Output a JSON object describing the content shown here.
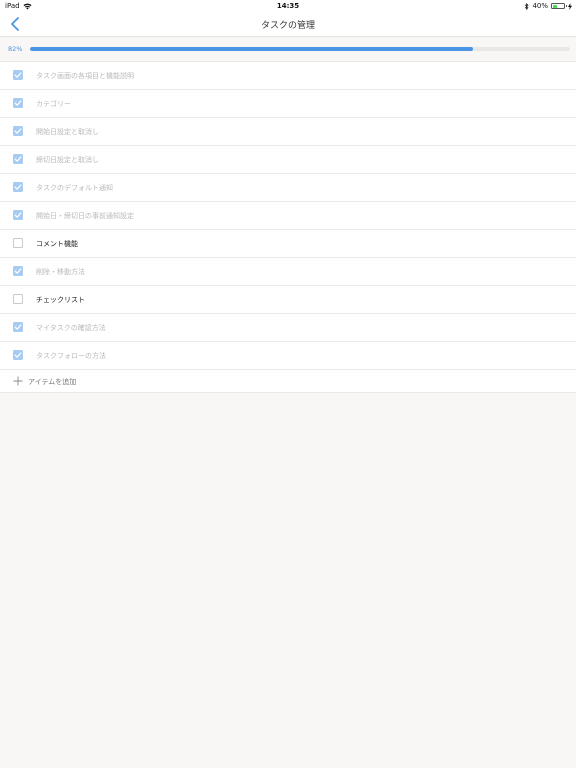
{
  "status_bar": {
    "device": "iPad",
    "time": "14:35",
    "battery": "40%",
    "battery_level": 0.4
  },
  "nav": {
    "title": "タスクの管理"
  },
  "progress": {
    "label": "82%",
    "value": 0.82,
    "color": "#4a95e6"
  },
  "items": [
    {
      "label": "タスク画面の各項目と機能説明",
      "checked": true
    },
    {
      "label": "カテゴリー",
      "checked": true
    },
    {
      "label": "開始日設定と取消し",
      "checked": true
    },
    {
      "label": "締切日設定と取消し",
      "checked": true
    },
    {
      "label": "タスクのデフォルト通知",
      "checked": true
    },
    {
      "label": "開始日・締切日の事前通知設定",
      "checked": true
    },
    {
      "label": "コメント機能",
      "checked": false
    },
    {
      "label": "削除・移動方法",
      "checked": true
    },
    {
      "label": "チェックリスト",
      "checked": false
    },
    {
      "label": "マイタスクの確認方法",
      "checked": true
    },
    {
      "label": "タスクフォローの方法",
      "checked": true
    }
  ],
  "add_item": {
    "label": "アイテムを追加"
  },
  "icons": {
    "back": "chevron-left-icon",
    "wifi": "wifi-icon",
    "bluetooth": "bluetooth-icon",
    "battery": "battery-icon",
    "charge": "charging-bolt-icon",
    "check": "checkmark-icon",
    "plus": "plus-icon"
  }
}
